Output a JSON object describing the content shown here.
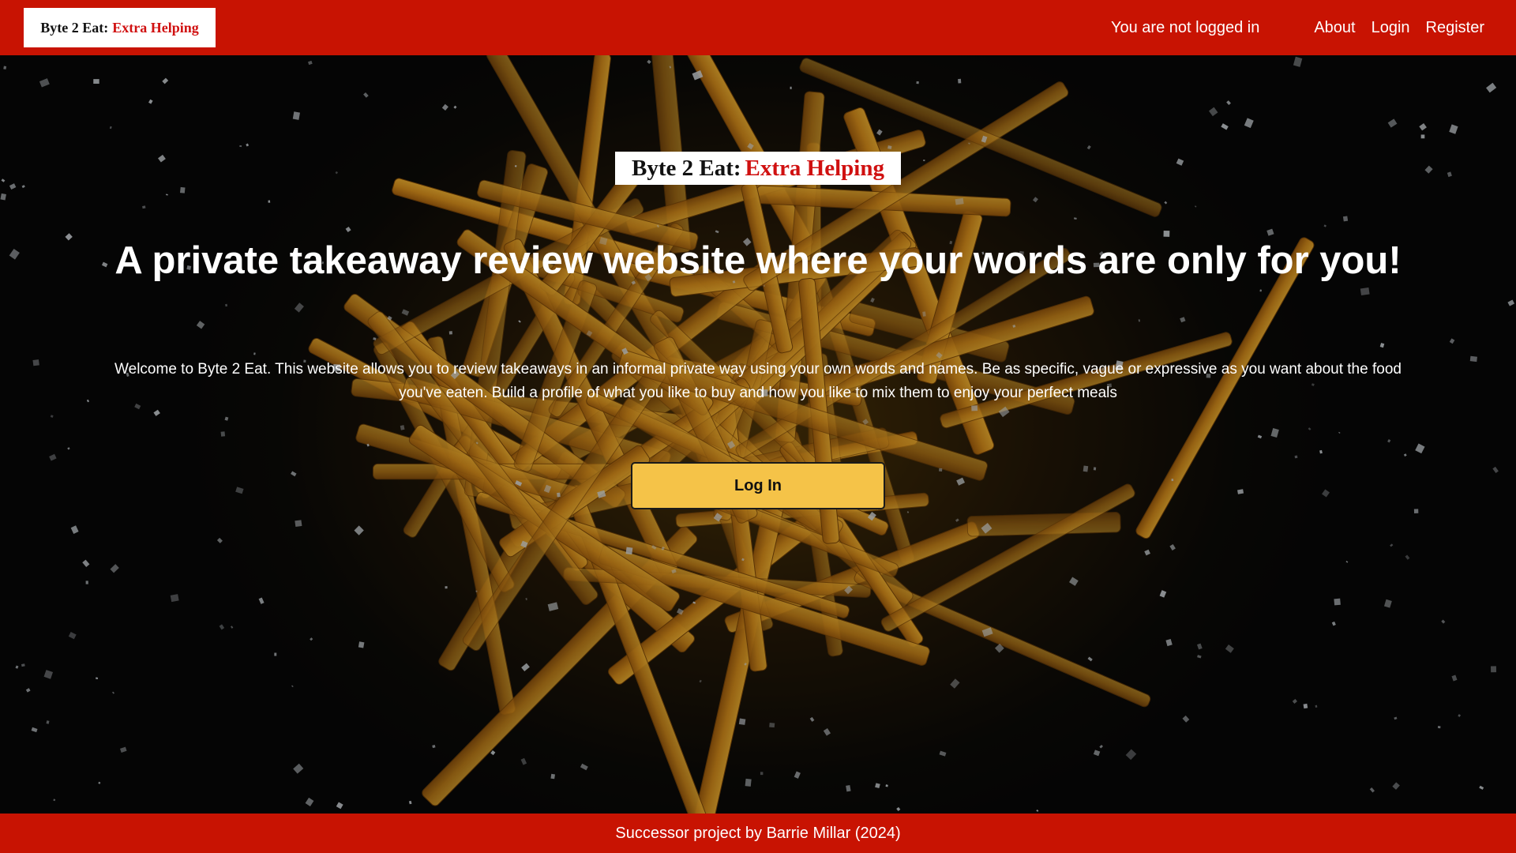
{
  "nav": {
    "logo_black": "Byte 2 Eat:",
    "logo_red": "Extra Helping",
    "status": "You are not logged in",
    "links": [
      "About",
      "Login",
      "Register"
    ]
  },
  "hero": {
    "logo_black": "Byte 2 Eat:",
    "logo_red": "Extra Helping",
    "title": "A private takeaway review website where your words are only for you!",
    "text": "Welcome to Byte 2 Eat. This website allows you to review takeaways in an informal private way using your own words and names. Be as specific, vague or expressive as you want about the food you've eaten. Build a profile of what you like to buy and how you like to mix them to enjoy your perfect meals",
    "button_label": "Log In"
  },
  "footer": {
    "text": "Successor project by Barrie Millar (2024)"
  },
  "colors": {
    "brand_red": "#c81302",
    "button_yellow": "#f5c348",
    "logo_red_text": "#d01010"
  },
  "background_image": "french-fries-with-salt"
}
